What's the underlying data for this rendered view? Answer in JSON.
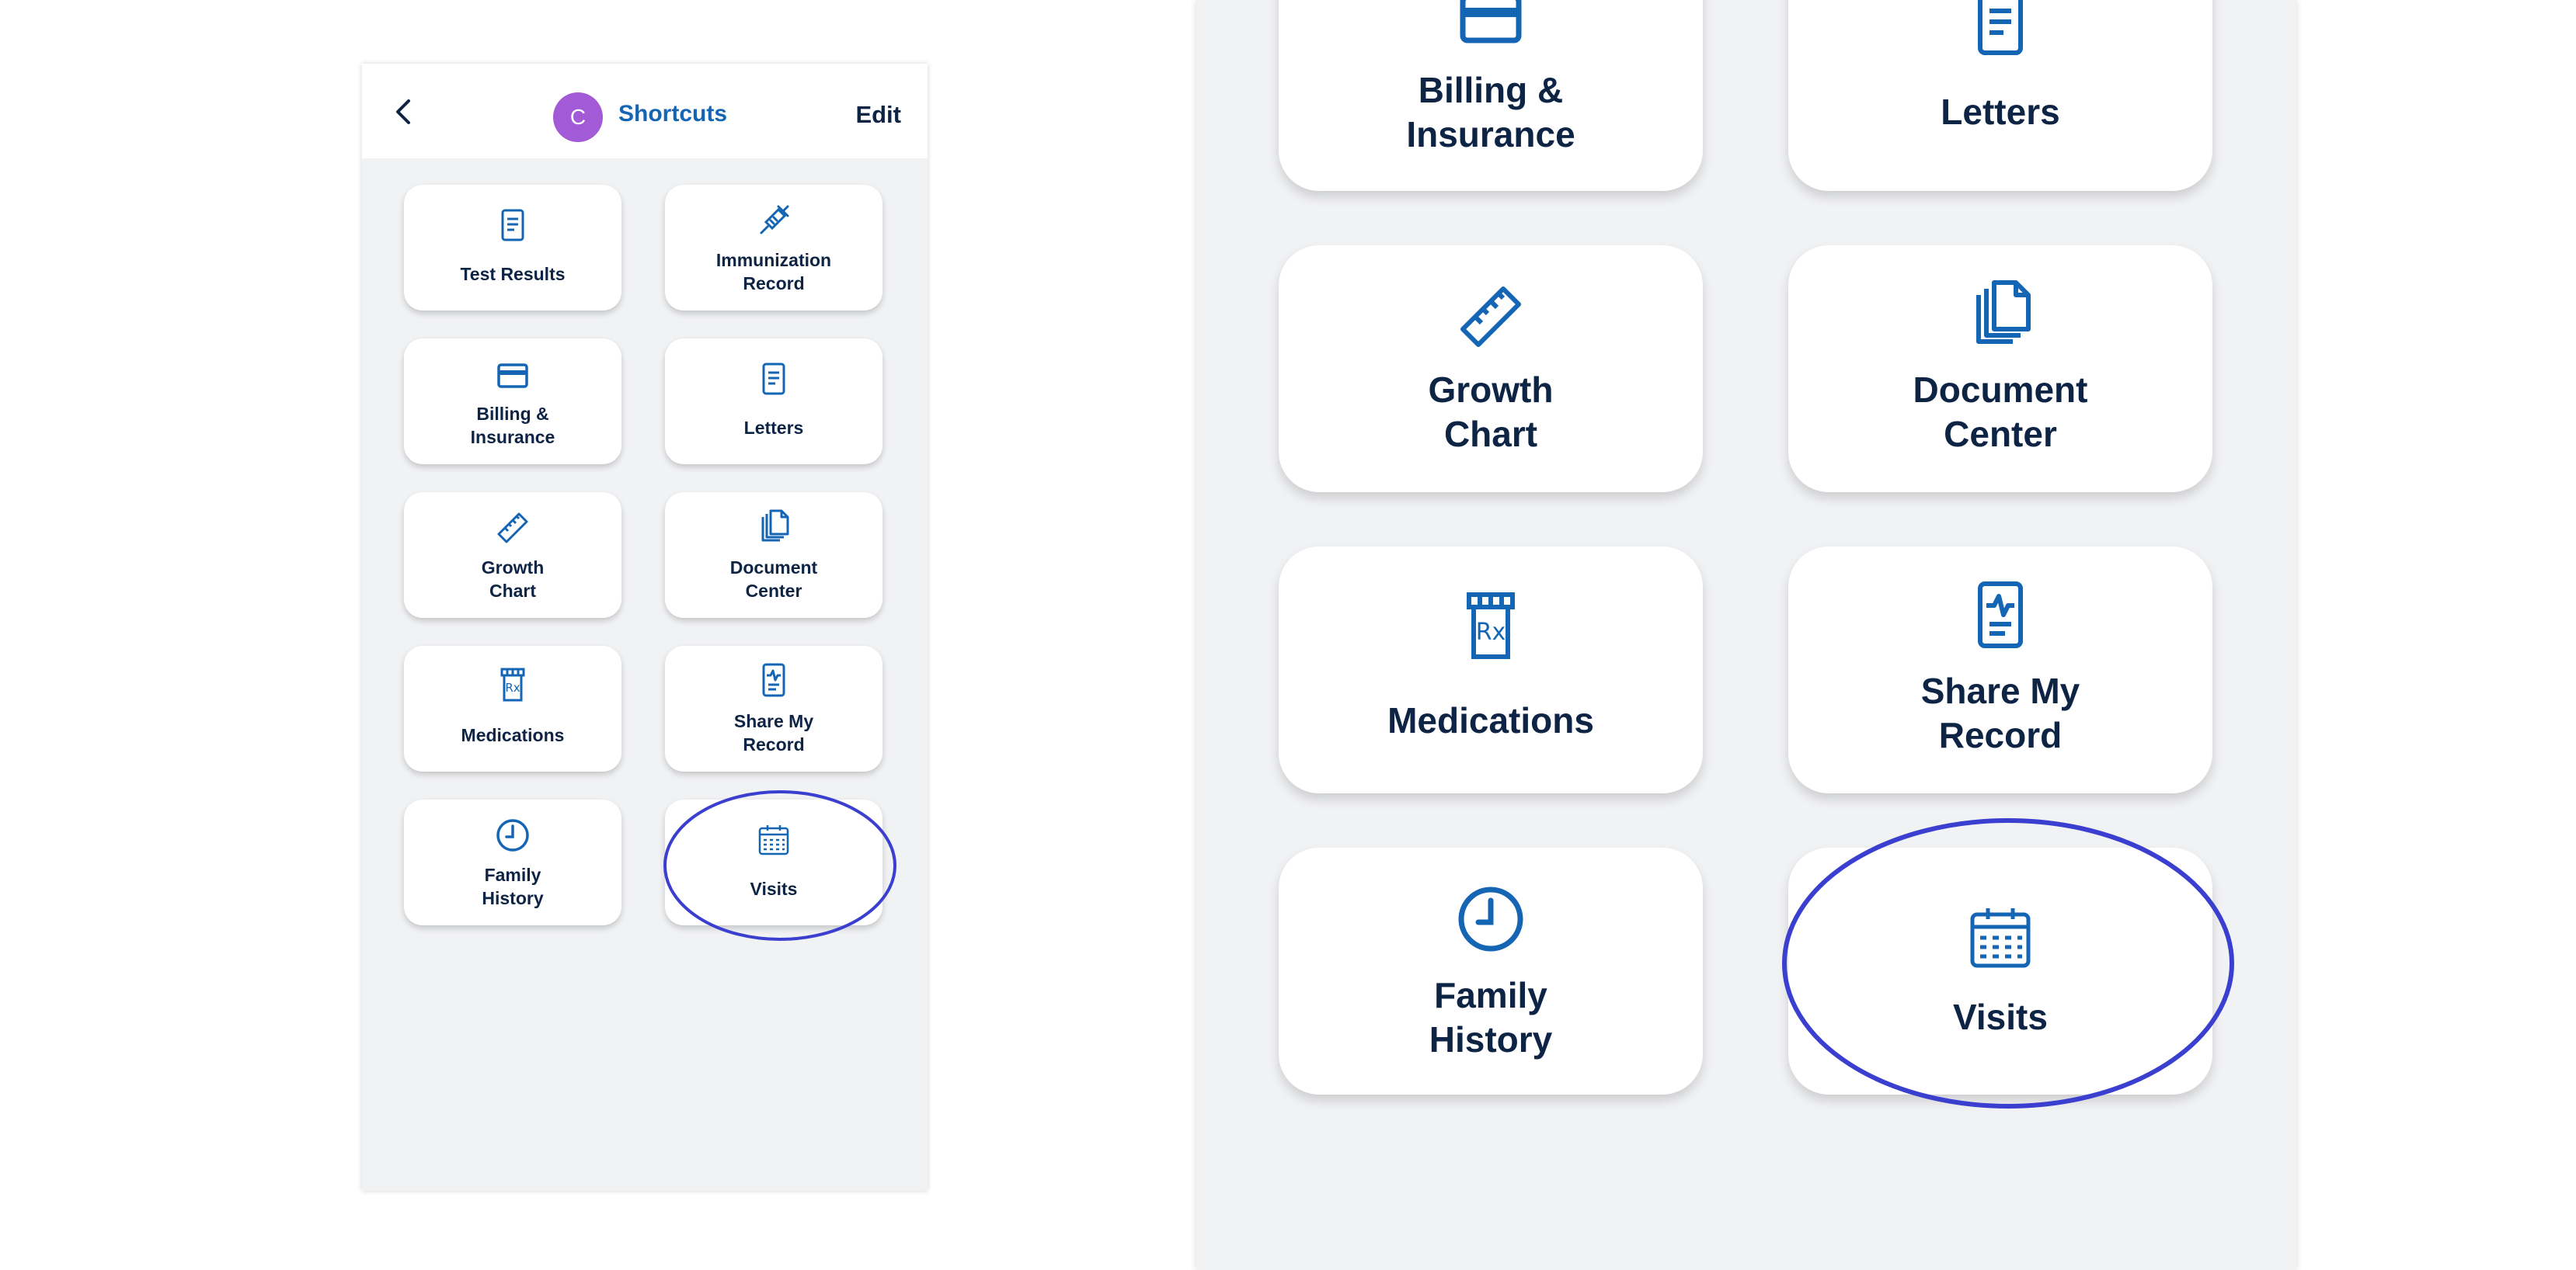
{
  "header": {
    "avatar_initial": "C",
    "title": "Shortcuts",
    "edit_label": "Edit"
  },
  "shortcuts": [
    {
      "label": "Test Results",
      "icon": "document-icon"
    },
    {
      "label": "Immunization\nRecord",
      "icon": "syringe-icon"
    },
    {
      "label": "Billing &\nInsurance",
      "icon": "credit-card-icon"
    },
    {
      "label": "Letters",
      "icon": "letter-icon"
    },
    {
      "label": "Growth\nChart",
      "icon": "ruler-icon"
    },
    {
      "label": "Document\nCenter",
      "icon": "documents-icon"
    },
    {
      "label": "Medications",
      "icon": "rx-bottle-icon"
    },
    {
      "label": "Share My\nRecord",
      "icon": "record-share-icon"
    },
    {
      "label": "Family\nHistory",
      "icon": "clock-icon"
    },
    {
      "label": "Visits",
      "icon": "calendar-icon"
    }
  ],
  "highlight": {
    "target": "Visits",
    "color": "#3b3fcf"
  },
  "colors": {
    "accent": "#1565b5",
    "text": "#0e2445",
    "avatar": "#a35ad6",
    "background": "#f1f2f4"
  }
}
